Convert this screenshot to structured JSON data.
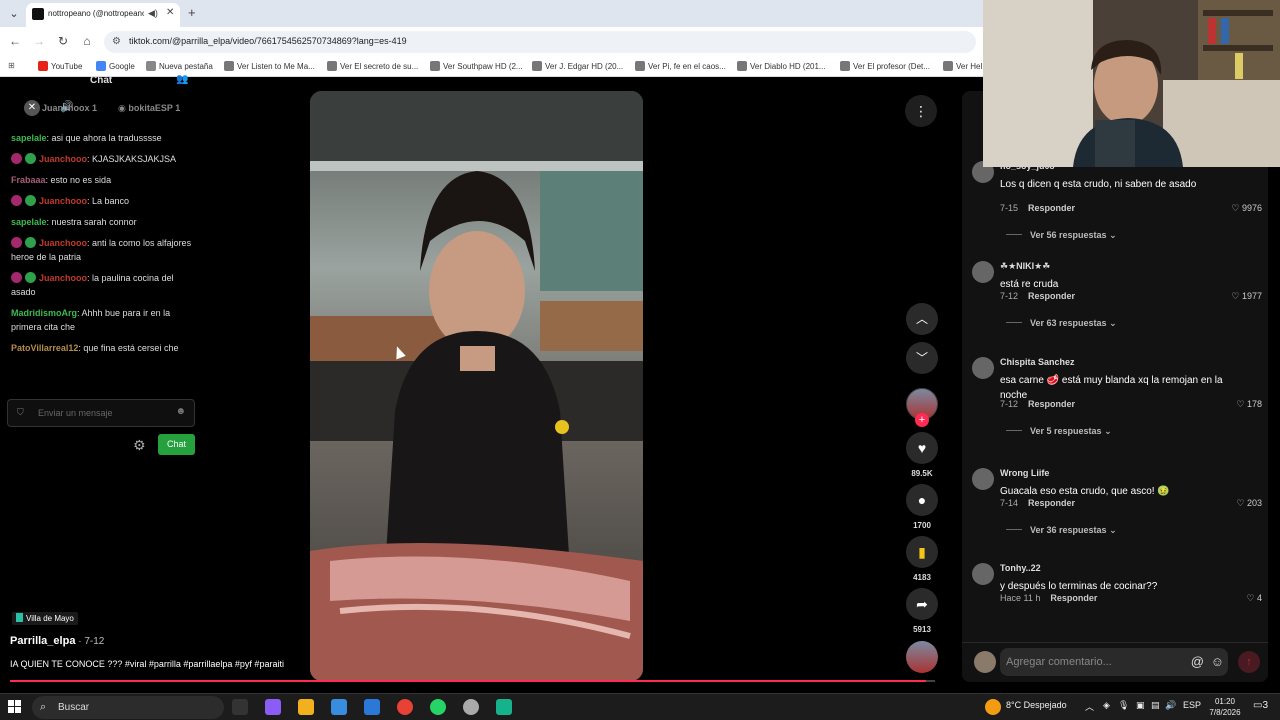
{
  "browser": {
    "tab_title": "nottropeano (@nottropeano",
    "url": "tiktok.com/@parrilla_elpa/video/7661754562570734869?lang=es-419",
    "bookmarks": [
      "YouTube",
      "Google",
      "Nueva pestaña",
      "Ver Listen to Me Ma...",
      "Ver El secreto de su...",
      "Ver Southpaw HD (2...",
      "Ver J. Edgar HD (20...",
      "Ver Pi, fe en el caos...",
      "Ver Diablo HD (201...",
      "Ver El profesor (Det...",
      "Ver Hel"
    ]
  },
  "chat": {
    "header": "Chat",
    "pinned_users": [
      "Juanchoox",
      "bokitaESP"
    ],
    "pinned_counts": [
      "1",
      "1"
    ],
    "messages": [
      {
        "user": "sapelale",
        "text": ": asi que ahora la tradusssse",
        "color": "#3fb950",
        "badges": 0
      },
      {
        "user": "Juanchooo",
        "text": ": KJASJKAKSJAKJSA",
        "color": "#c0392b",
        "badges": 2
      },
      {
        "user": "Frabaaa",
        "text": ": esto no es sida",
        "color": "#a85c7a",
        "badges": 0
      },
      {
        "user": "Juanchooo",
        "text": ": La banco",
        "color": "#c0392b",
        "badges": 2
      },
      {
        "user": "sapelale",
        "text": ": nuestra sarah connor",
        "color": "#3fb950",
        "badges": 0
      },
      {
        "user": "Juanchooo",
        "text": ": anti la como los alfajores heroe de la patria",
        "color": "#c0392b",
        "badges": 2
      },
      {
        "user": "Juanchooo",
        "text": ": la paulina cocina del asado",
        "color": "#c0392b",
        "badges": 2
      },
      {
        "user": "MadridismoArg",
        "text": ": Ahhh bue para ir en la primera cita che",
        "color": "#3fb950",
        "badges": 0
      },
      {
        "user": "PatoVillarreal12",
        "text": ": que fina está cersei che",
        "color": "#b58b4c",
        "badges": 0
      }
    ],
    "input_placeholder": "Enviar un mensaje",
    "send_label": "Chat"
  },
  "video": {
    "location": "Villa de Mayo",
    "author": "Parrilla_elpa",
    "date": " · 7-12",
    "caption": "IA QUIEN TE CONOCE ??? #viral #parrilla #parrillaelpa #pyf #paraiti",
    "likes": "89.5K",
    "comments": "1700",
    "saves": "4183",
    "shares": "5913",
    "progress": 0.99
  },
  "comments": [
    {
      "user": "no_soy_ju08",
      "text": "Los q dicen q esta crudo, ni saben de asado",
      "date": "7-15",
      "likes": "9976",
      "replies": "Ver 56 respuestas"
    },
    {
      "user": "☘★NIKI★☘",
      "text": "está re cruda",
      "date": "7-12",
      "likes": "1977",
      "replies": "Ver 63 respuestas"
    },
    {
      "user": "Chispita Sanchez",
      "text": "esa carne 🥩 está muy blanda xq la remojan en la noche",
      "date": "7-12",
      "likes": "178",
      "replies": "Ver 5 respuestas"
    },
    {
      "user": "Wrong Liife",
      "text": "Guacala eso esta crudo, que asco! 🤢",
      "date": "7-14",
      "likes": "203",
      "replies": "Ver 36 respuestas"
    },
    {
      "user": "Tonhy..22",
      "text": "y después lo terminas de cocinar??",
      "date": "Hace 11 h",
      "likes": "4",
      "replies": ""
    }
  ],
  "reply_label": "Responder",
  "comment_placeholder": "Agregar comentario...",
  "taskbar": {
    "search": "Buscar",
    "weather": "8°C Despejado",
    "lang": "ESP",
    "time": "01:20",
    "date": "7/8/2026",
    "notifications": "3"
  }
}
